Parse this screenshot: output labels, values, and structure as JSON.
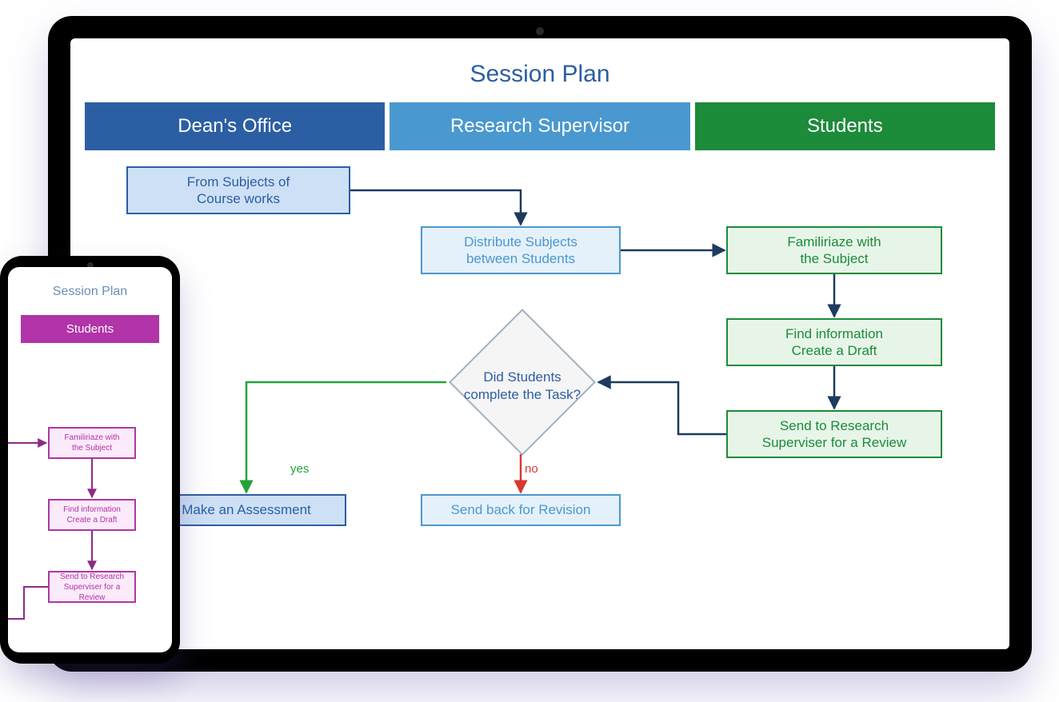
{
  "title": "Session Plan",
  "lanes": {
    "dean": "Dean's Office",
    "research": "Research Supervisor",
    "students": "Students"
  },
  "nodes": {
    "from_subjects": "From Subjects of\nCourse works",
    "distribute": "Distribute Subjects\nbetween Students",
    "familiarize": "Familiriaze with\nthe Subject",
    "find_info": "Find information\nCreate a Draft",
    "send_review": "Send to Research\nSuperviser for a Review",
    "decision": "Did Students\ncomplete the Task?",
    "assessment": "Make an Assessment",
    "revision": "Send back for Revision"
  },
  "edges": {
    "yes": "yes",
    "no": "no"
  },
  "phone": {
    "title": "Session Plan",
    "lane": "Students",
    "familiarize": "Familiriaze with\nthe Subject",
    "find_info": "Find information\nCreate a Draft",
    "send_review": "Send to Research\nSuperviser for a Review"
  },
  "chart_data": {
    "type": "flowchart",
    "title": "Session Plan",
    "swimlanes": [
      "Dean's Office",
      "Research Supervisor",
      "Students"
    ],
    "nodes": [
      {
        "id": "from_subjects",
        "lane": "Dean's Office",
        "label": "From Subjects of Course works",
        "shape": "process"
      },
      {
        "id": "distribute",
        "lane": "Research Supervisor",
        "label": "Distribute Subjects between Students",
        "shape": "process"
      },
      {
        "id": "familiarize",
        "lane": "Students",
        "label": "Familiriaze with the Subject",
        "shape": "process"
      },
      {
        "id": "find_info",
        "lane": "Students",
        "label": "Find information Create a Draft",
        "shape": "process"
      },
      {
        "id": "send_review",
        "lane": "Students",
        "label": "Send to Research Superviser for a Review",
        "shape": "process"
      },
      {
        "id": "decision",
        "lane": "Research Supervisor",
        "label": "Did Students complete the Task?",
        "shape": "decision"
      },
      {
        "id": "assessment",
        "lane": "Dean's Office",
        "label": "Make an Assessment",
        "shape": "process"
      },
      {
        "id": "revision",
        "lane": "Research Supervisor",
        "label": "Send back for Revision",
        "shape": "process"
      }
    ],
    "edges": [
      {
        "from": "from_subjects",
        "to": "distribute"
      },
      {
        "from": "distribute",
        "to": "familiarize"
      },
      {
        "from": "familiarize",
        "to": "find_info"
      },
      {
        "from": "find_info",
        "to": "send_review"
      },
      {
        "from": "send_review",
        "to": "decision"
      },
      {
        "from": "decision",
        "to": "assessment",
        "label": "yes"
      },
      {
        "from": "decision",
        "to": "revision",
        "label": "no"
      }
    ]
  }
}
